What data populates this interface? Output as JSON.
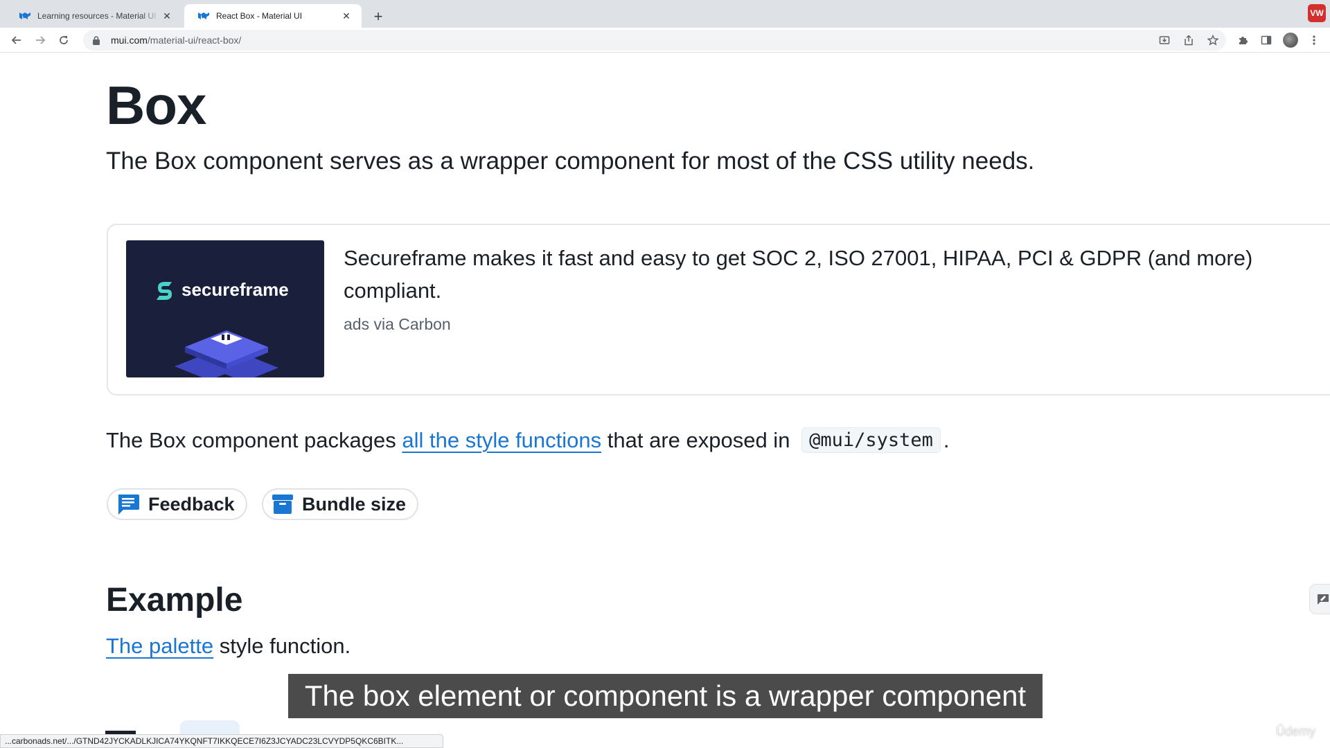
{
  "browser": {
    "tabs": [
      {
        "title": "Learning resources - Material UI",
        "active": false
      },
      {
        "title": "React Box - Material UI",
        "active": true
      }
    ],
    "new_tab_symbol": "+",
    "close_symbol": "✕",
    "profile_badge": "VW",
    "address": {
      "host": "mui.com",
      "path": "/material-ui/react-box/"
    },
    "icons": [
      "back-icon",
      "forward-icon",
      "reload-icon",
      "lock-icon",
      "install-icon",
      "share-icon",
      "star-icon",
      "extensions-icon",
      "side-panel-icon",
      "avatar",
      "kebab-menu-icon"
    ]
  },
  "page": {
    "title": "Box",
    "lead": "The Box component serves as a wrapper component for most of the CSS utility needs.",
    "ad": {
      "brand": "secureframe",
      "text": "Secureframe makes it fast and easy to get SOC 2, ISO 27001, HIPAA, PCI & GDPR (and more) compliant.",
      "via": "ads via Carbon"
    },
    "packages_para": {
      "before": "The Box component packages ",
      "link": "all the style functions",
      "middle": " that are exposed in ",
      "code": "@mui/system",
      "after": "."
    },
    "buttons": {
      "feedback": "Feedback",
      "bundle_size": "Bundle size"
    },
    "example": {
      "heading": "Example",
      "link": "The palette",
      "rest": " style function."
    }
  },
  "overlay": {
    "subtitle": "The box element or component is a wrapper component",
    "status_url": "...carbonads.net/.../GTND42JYCKADLKJICA74YKQNFT7IKKQECE7I6Z3JCYADC23LCVYDP5QKC6BITK...",
    "watermark": "Ûdemy"
  },
  "colors": {
    "link": "#1976d2",
    "primary_icon": "#1976d2",
    "ad_background": "#1a1f3c",
    "ad_accent": "#4e59d8",
    "profile_badge": "#d32f2f"
  }
}
